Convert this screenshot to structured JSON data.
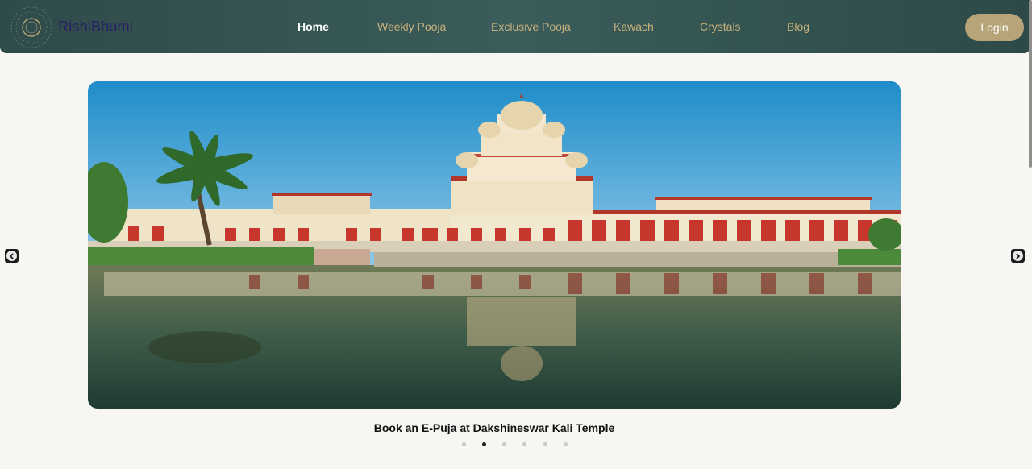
{
  "header": {
    "brand": "RishiBhumi",
    "logo_ring_text": "RISHIBHUMI",
    "nav": [
      {
        "label": "Home",
        "active": true
      },
      {
        "label": "Weekly Pooja",
        "active": false
      },
      {
        "label": "Exclusive Pooja",
        "active": false
      },
      {
        "label": "Kawach",
        "active": false
      },
      {
        "label": "Crystals",
        "active": false
      },
      {
        "label": "Blog",
        "active": false
      }
    ],
    "login_label": "Login"
  },
  "carousel": {
    "caption": "Book an E-Puja at Dakshineswar Kali Temple",
    "slide_count": 6,
    "active_slide": 2,
    "prev_icon": "chevron-left-icon",
    "next_icon": "chevron-right-icon"
  },
  "colors": {
    "nav_bg": "#34524f",
    "nav_text": "#c8b27c",
    "accent": "#b7a479",
    "page_bg": "#f8f6f2"
  }
}
